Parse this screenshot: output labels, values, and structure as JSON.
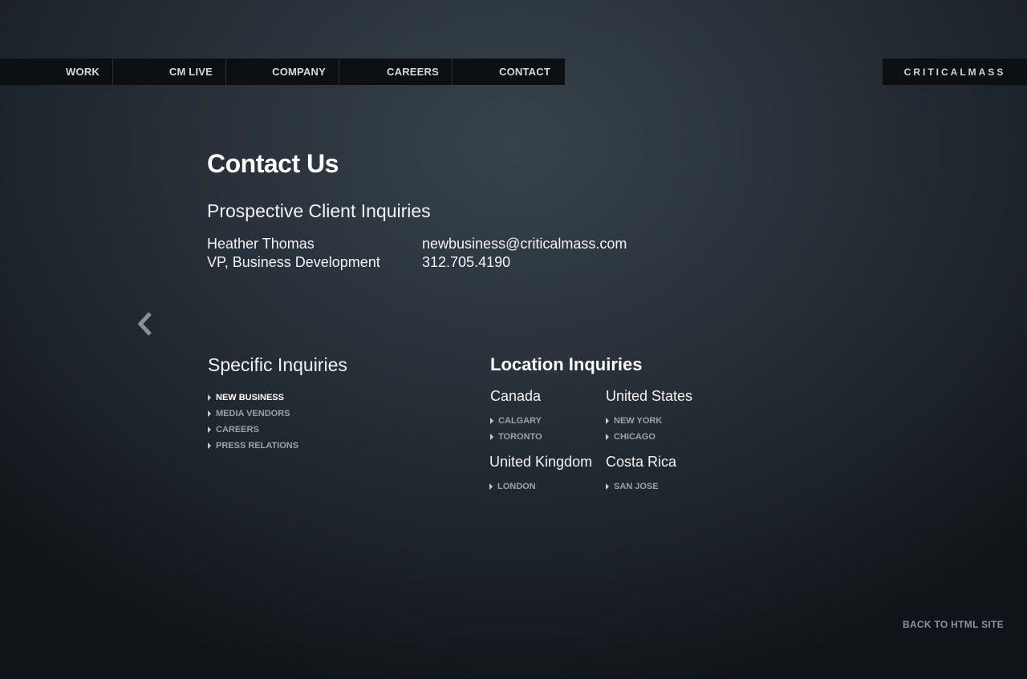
{
  "nav": {
    "items": [
      {
        "label": "WORK"
      },
      {
        "label": "CM LIVE"
      },
      {
        "label": "COMPANY"
      },
      {
        "label": "CAREERS"
      },
      {
        "label": "CONTACT"
      }
    ]
  },
  "logo": "CRITICALMASS",
  "page": {
    "title": "Contact Us",
    "prospective": {
      "title": "Prospective Client Inquiries",
      "name": "Heather Thomas",
      "role": "VP, Business Development",
      "email": "newbusiness@criticalmass.com",
      "phone": "312.705.4190"
    },
    "specific": {
      "title": "Specific Inquiries",
      "links": [
        "NEW BUSINESS",
        "MEDIA VENDORS",
        "CAREERS",
        "PRESS RELATIONS"
      ],
      "active": "NEW BUSINESS"
    },
    "location": {
      "title": "Location Inquiries",
      "regions": [
        {
          "name": "Canada",
          "cities": [
            "CALGARY",
            "TORONTO"
          ]
        },
        {
          "name": "United States",
          "cities": [
            "NEW YORK",
            "CHICAGO"
          ]
        },
        {
          "name": "United Kingdom",
          "cities": [
            "LONDON"
          ]
        },
        {
          "name": "Costa Rica",
          "cities": [
            "SAN JOSE"
          ]
        }
      ]
    }
  },
  "footer": {
    "back_link": "BACK TO HTML SITE"
  },
  "icons": {
    "back": "chevron-left-icon",
    "bullet": "triangle-right-icon"
  }
}
